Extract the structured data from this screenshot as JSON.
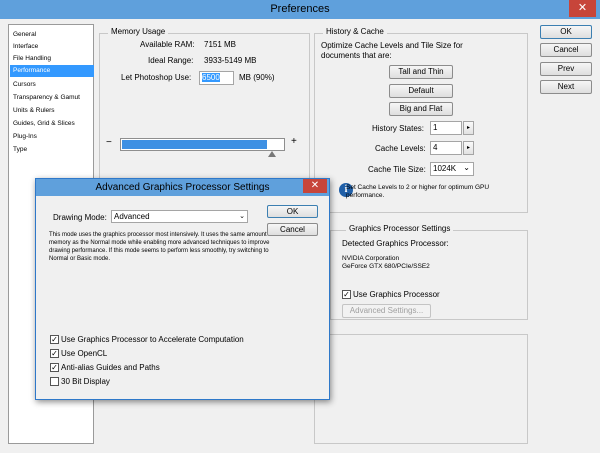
{
  "window": {
    "title": "Preferences",
    "close_glyph": "✕"
  },
  "sidebar": {
    "items": [
      {
        "label": "General"
      },
      {
        "label": "Interface"
      },
      {
        "label": "File Handling"
      },
      {
        "label": "Performance",
        "selected": true
      },
      {
        "label": "Cursors"
      },
      {
        "label": "Transparency & Gamut"
      },
      {
        "label": "Units & Rulers"
      },
      {
        "label": "Guides, Grid & Slices"
      },
      {
        "label": "Plug-Ins"
      },
      {
        "label": "Type"
      }
    ]
  },
  "memory": {
    "legend": "Memory Usage",
    "available_label": "Available RAM:",
    "available_value": "7151 MB",
    "ideal_label": "Ideal Range:",
    "ideal_value": "3933-5149 MB",
    "let_label": "Let Photoshop Use:",
    "let_value": "6500",
    "let_suffix": "MB (90%)",
    "minus": "−",
    "plus": "+",
    "slider_fraction": 0.9
  },
  "history": {
    "legend": "History & Cache",
    "desc": "Optimize Cache Levels and Tile Size for documents that are:",
    "tall_thin": "Tall and Thin",
    "default": "Default",
    "big_flat": "Big and Flat",
    "states_label": "History States:",
    "states_value": "1",
    "levels_label": "Cache Levels:",
    "levels_value": "4",
    "tile_label": "Cache Tile Size:",
    "tile_value": "1024K",
    "spin_glyph": "▸",
    "dropdown_glyph": "⌄",
    "info_glyph": "i",
    "info_text": "Set Cache Levels to 2 or higher for optimum GPU performance."
  },
  "gpu": {
    "legend": "Graphics Processor Settings",
    "detected_label": "Detected Graphics Processor:",
    "vendor": "NVIDIA Corporation",
    "model": "GeForce GTX 680/PCIe/SSE2",
    "use_gpu_label": "Use Graphics Processor",
    "use_gpu_checked": true,
    "advanced_button": "Advanced Settings..."
  },
  "buttons": {
    "ok": "OK",
    "cancel": "Cancel",
    "prev": "Prev",
    "next": "Next"
  },
  "dialog": {
    "title": "Advanced Graphics Processor Settings",
    "close_glyph": "✕",
    "mode_label": "Drawing Mode:",
    "mode_value": "Advanced",
    "dropdown_glyph": "⌄",
    "mode_desc": "This mode uses the graphics processor most intensively.  It uses the same amount of memory as the Normal mode while enabling more advanced techniques to improve drawing performance.  If this mode seems to perform less smoothly, try switching to Normal or Basic mode.",
    "ok": "OK",
    "cancel": "Cancel",
    "check_glyph": "✓",
    "options": [
      {
        "label": "Use Graphics Processor to Accelerate Computation",
        "checked": true
      },
      {
        "label": "Use OpenCL",
        "checked": true
      },
      {
        "label": "Anti-alias Guides and Paths",
        "checked": true
      },
      {
        "label": "30 Bit Display",
        "checked": false
      }
    ]
  },
  "colors": {
    "accent": "#3399ff",
    "titlebar": "#5fa0dc",
    "close": "#c7453a",
    "slider_fill": "#3e90e3"
  }
}
